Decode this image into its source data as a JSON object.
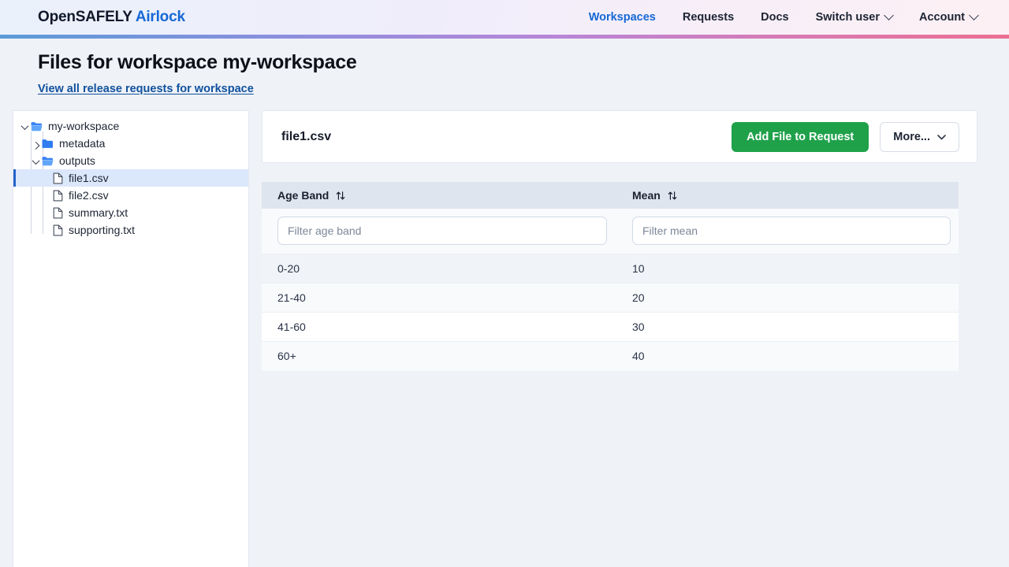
{
  "header": {
    "brand_main": "OpenSAFELY",
    "brand_accent": "Airlock",
    "nav": [
      {
        "label": "Workspaces",
        "active": true,
        "caret": false
      },
      {
        "label": "Requests",
        "active": false,
        "caret": false
      },
      {
        "label": "Docs",
        "active": false,
        "caret": false
      },
      {
        "label": "Switch user",
        "active": false,
        "caret": true
      },
      {
        "label": "Account",
        "active": false,
        "caret": true
      }
    ],
    "accent_color": "#1668d4"
  },
  "page": {
    "title": "Files for workspace my-workspace",
    "link": "View all release requests for workspace"
  },
  "tree": {
    "nodes": [
      {
        "label": "my-workspace",
        "type": "folder-open",
        "depth": 0,
        "expanded": true,
        "selected": false
      },
      {
        "label": "metadata",
        "type": "folder-closed",
        "depth": 1,
        "expanded": false,
        "selected": false
      },
      {
        "label": "outputs",
        "type": "folder-open",
        "depth": 1,
        "expanded": true,
        "selected": false
      },
      {
        "label": "file1.csv",
        "type": "file",
        "depth": 2,
        "selected": true
      },
      {
        "label": "file2.csv",
        "type": "file",
        "depth": 2,
        "selected": false
      },
      {
        "label": "summary.txt",
        "type": "file",
        "depth": 2,
        "selected": false
      },
      {
        "label": "supporting.txt",
        "type": "file",
        "depth": 2,
        "selected": false
      }
    ]
  },
  "file_card": {
    "title": "file1.csv",
    "add_button": "Add File to Request",
    "more_button": "More...",
    "add_button_color": "#1fa14a"
  },
  "table": {
    "columns": [
      {
        "label": "Age Band",
        "sortable": true,
        "filter_placeholder": "Filter age band"
      },
      {
        "label": "Mean",
        "sortable": true,
        "filter_placeholder": "Filter mean"
      }
    ],
    "rows": [
      {
        "age_band": "0-20",
        "mean": "10"
      },
      {
        "age_band": "21-40",
        "mean": "20"
      },
      {
        "age_band": "41-60",
        "mean": "30"
      },
      {
        "age_band": "60+",
        "mean": "40"
      }
    ]
  }
}
